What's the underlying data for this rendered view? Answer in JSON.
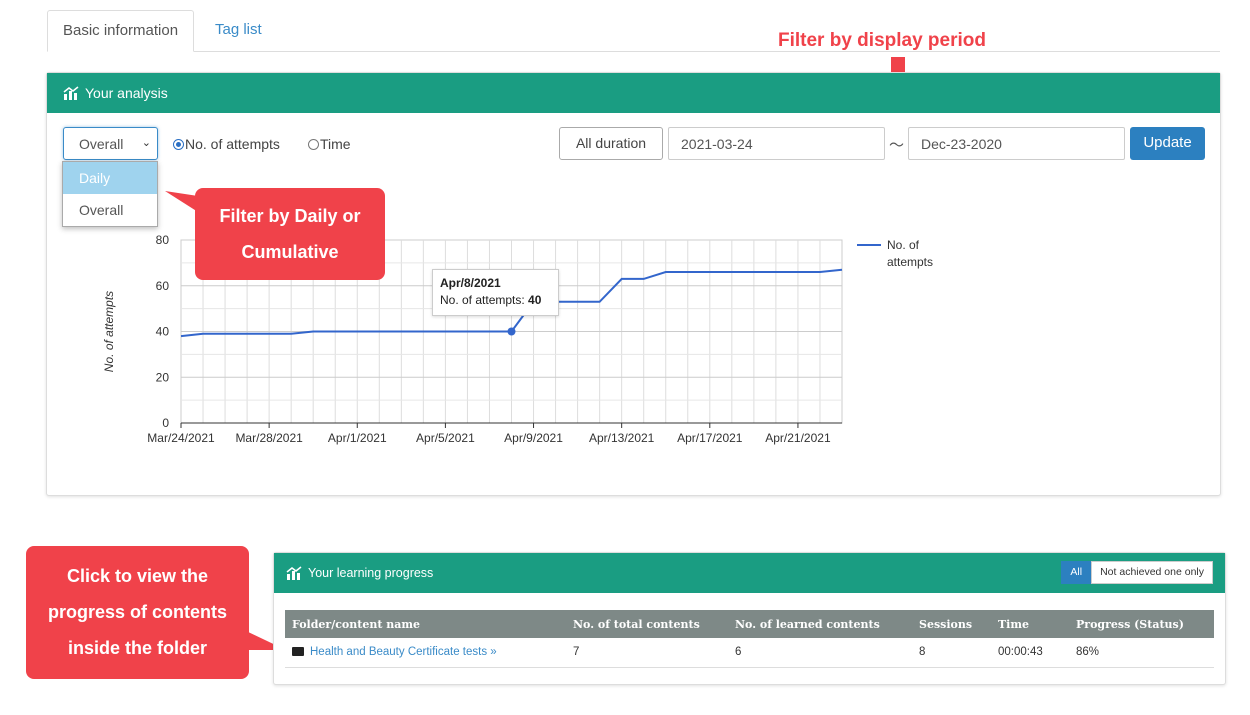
{
  "tabs": [
    {
      "label": "Basic information"
    },
    {
      "label": "Tag list"
    }
  ],
  "analysis": {
    "title": "Your analysis",
    "select_value": "Overall",
    "dropdown_options": [
      "Daily",
      "Overall"
    ],
    "radios": [
      {
        "label": "No. of attempts",
        "checked": true
      },
      {
        "label": "Time",
        "checked": false
      }
    ],
    "all_duration": "All duration",
    "date_from": "2021-03-24",
    "tilde": "～",
    "date_to": "Dec-23-2020",
    "update": "Update"
  },
  "tooltip": {
    "date": "Apr/8/2021",
    "label": "No. of attempts:",
    "value": "40"
  },
  "chart_data": {
    "type": "line",
    "ylabel": "No. of attempts",
    "ylim": [
      0,
      80
    ],
    "yticks": [
      0,
      20,
      40,
      60,
      80
    ],
    "xtick_labels": [
      "Mar/24/2021",
      "Mar/28/2021",
      "Apr/1/2021",
      "Apr/5/2021",
      "Apr/9/2021",
      "Apr/13/2021",
      "Apr/17/2021",
      "Apr/21/2021"
    ],
    "series": [
      {
        "name": "No. of attempts",
        "color": "#3366cc",
        "x": [
          "Mar/24/2021",
          "Mar/25/2021",
          "Mar/26/2021",
          "Mar/27/2021",
          "Mar/28/2021",
          "Mar/29/2021",
          "Mar/30/2021",
          "Mar/31/2021",
          "Apr/1/2021",
          "Apr/2/2021",
          "Apr/3/2021",
          "Apr/4/2021",
          "Apr/5/2021",
          "Apr/6/2021",
          "Apr/7/2021",
          "Apr/8/2021",
          "Apr/9/2021",
          "Apr/10/2021",
          "Apr/11/2021",
          "Apr/12/2021",
          "Apr/13/2021",
          "Apr/14/2021",
          "Apr/15/2021",
          "Apr/16/2021",
          "Apr/17/2021",
          "Apr/18/2021",
          "Apr/19/2021",
          "Apr/20/2021",
          "Apr/21/2021",
          "Apr/22/2021",
          "Apr/23/2021"
        ],
        "values": [
          38,
          39,
          39,
          39,
          39,
          39,
          40,
          40,
          40,
          40,
          40,
          40,
          40,
          40,
          40,
          40,
          53,
          53,
          53,
          53,
          63,
          63,
          66,
          66,
          66,
          66,
          66,
          66,
          66,
          66,
          67
        ]
      }
    ],
    "legend_position": "right"
  },
  "annotations": {
    "period": "Filter by display period",
    "daily_line1": "Filter by Daily or",
    "daily_line2": "Cumulative",
    "folder_line1": "Click to view the",
    "folder_line2": "progress of contents",
    "folder_line3": "inside the folder"
  },
  "progress": {
    "title": "Your learning progress",
    "filter_all": "All",
    "filter_not_achieved": "Not achieved one only",
    "columns": [
      "Folder/content name",
      "No. of total contents",
      "No. of learned contents",
      "Sessions",
      "Time",
      "Progress (Status)"
    ],
    "rows": [
      {
        "name": "Health and Beauty Certificate tests »",
        "total": "7",
        "learned": "6",
        "sessions": "8",
        "time": "00:00:43",
        "progress": "86%"
      }
    ]
  },
  "colors": {
    "header_green": "#1a9d82",
    "accent_blue": "#2c80c0",
    "annotation_red": "#f0424a",
    "line_blue": "#3366cc"
  }
}
